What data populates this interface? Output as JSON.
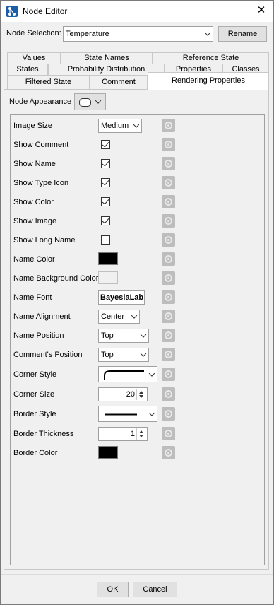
{
  "window": {
    "title": "Node Editor",
    "close_glyph": "✕"
  },
  "selection": {
    "label": "Node Selection:",
    "value": "Temperature",
    "rename_label": "Rename"
  },
  "tabs": {
    "row1": [
      "Values",
      "State Names",
      "Reference State"
    ],
    "row2": [
      "States",
      "Probability Distribution",
      "Properties",
      "Classes"
    ],
    "row3": [
      "Filtered State",
      "Comment",
      "Rendering Properties"
    ],
    "active": "Rendering Properties"
  },
  "appearance": {
    "label": "Node Appearance",
    "icon": "node-shape-icon"
  },
  "properties": [
    {
      "label": "Image Size",
      "control": "combo",
      "value": "Medium"
    },
    {
      "label": "Show Comment",
      "control": "checkbox",
      "checked": true
    },
    {
      "label": "Show Name",
      "control": "checkbox",
      "checked": true
    },
    {
      "label": "Show Type Icon",
      "control": "checkbox",
      "checked": true
    },
    {
      "label": "Show Color",
      "control": "checkbox",
      "checked": true
    },
    {
      "label": "Show Image",
      "control": "checkbox",
      "checked": true
    },
    {
      "label": "Show Long Name",
      "control": "checkbox",
      "checked": false
    },
    {
      "label": "Name Color",
      "control": "color",
      "value": "#000000"
    },
    {
      "label": "Name Background Color",
      "control": "color",
      "value": "#f0f0f0"
    },
    {
      "label": "Name Font",
      "control": "font",
      "value": "BayesiaLab"
    },
    {
      "label": "Name Alignment",
      "control": "combo",
      "value": "Center"
    },
    {
      "label": "Name Position",
      "control": "combo",
      "value": "Top"
    },
    {
      "label": "Comment's Position",
      "control": "combo",
      "value": "Top"
    },
    {
      "label": "Corner Style",
      "control": "corner",
      "value": "rounded"
    },
    {
      "label": "Corner Size",
      "control": "spinner",
      "value": "20"
    },
    {
      "label": "Border Style",
      "control": "line",
      "value": "solid"
    },
    {
      "label": "Border Thickness",
      "control": "spinner",
      "value": "1"
    },
    {
      "label": "Border Color",
      "control": "color",
      "value": "#000000"
    }
  ],
  "footer": {
    "ok_label": "OK",
    "cancel_label": "Cancel"
  },
  "colors": {
    "reset_button": "#bdbdbd",
    "title_bar": "#ffffff",
    "active_tab": "#ffffff"
  },
  "icons": {
    "app": "node-editor-icon",
    "reset": "reset-icon",
    "dropdown": "chevron-down-icon"
  }
}
